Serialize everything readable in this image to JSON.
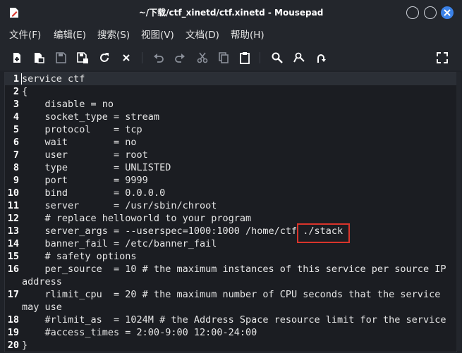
{
  "window": {
    "title": "~/下载/ctf_xinetd/ctf.xinetd - Mousepad",
    "icons": [
      "app-icon",
      "minimize-icon",
      "maximize-icon",
      "close-icon"
    ]
  },
  "menu": [
    "文件(F)",
    "编辑(E)",
    "搜索(S)",
    "视图(V)",
    "文档(D)",
    "帮助(H)"
  ],
  "toolbar": [
    "new-document-icon",
    "new-window-icon",
    "save-icon",
    "save-as-icon",
    "reload-icon",
    "close-tab-icon",
    "undo-icon",
    "redo-icon",
    "cut-icon",
    "copy-icon",
    "paste-icon",
    "find-icon",
    "find-replace-icon",
    "go-to-line-icon",
    "fullscreen-icon"
  ],
  "editor": {
    "lines": [
      {
        "num": "1",
        "text": "service ctf"
      },
      {
        "num": "2",
        "text": "{"
      },
      {
        "num": "3",
        "text": "    disable = no"
      },
      {
        "num": "4",
        "text": "    socket_type = stream"
      },
      {
        "num": "5",
        "text": "    protocol    = tcp"
      },
      {
        "num": "6",
        "text": "    wait        = no"
      },
      {
        "num": "7",
        "text": "    user        = root"
      },
      {
        "num": "8",
        "text": "    type        = UNLISTED"
      },
      {
        "num": "9",
        "text": "    port        = 9999"
      },
      {
        "num": "10",
        "text": "    bind        = 0.0.0.0"
      },
      {
        "num": "11",
        "text": "    server      = /usr/sbin/chroot"
      },
      {
        "num": "12",
        "text": "    # replace helloworld to your program"
      },
      {
        "num": "13",
        "text": "    server_args = --userspec=1000:1000 /home/ctf ./stack"
      },
      {
        "num": "14",
        "text": "    banner_fail = /etc/banner_fail"
      },
      {
        "num": "15",
        "text": "    # safety options"
      },
      {
        "num": "16",
        "text": "    per_source  = 10 # the maximum instances of this service per source IP"
      },
      {
        "num": "",
        "text": "address"
      },
      {
        "num": "17",
        "text": "    rlimit_cpu  = 20 # the maximum number of CPU seconds that the service"
      },
      {
        "num": "",
        "text": "may use"
      },
      {
        "num": "18",
        "text": "    #rlimit_as  = 1024M # the Address Space resource limit for the service"
      },
      {
        "num": "19",
        "text": "    #access_times = 2:00-9:00 12:00-24:00"
      },
      {
        "num": "20",
        "text": "}"
      }
    ],
    "highlighted_text": "./stack",
    "highlight_color": "#d9342b"
  }
}
